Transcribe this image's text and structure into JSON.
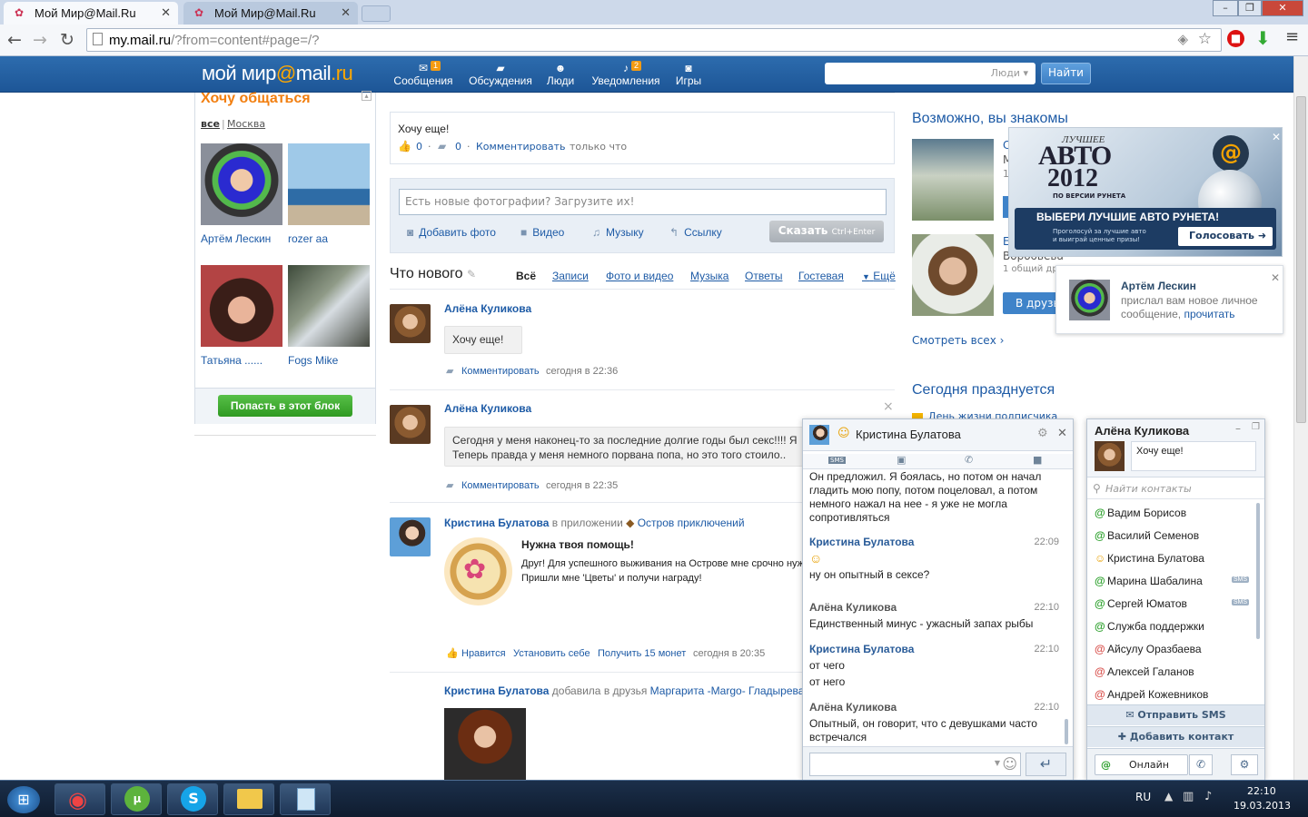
{
  "browser": {
    "tabs": [
      {
        "title": "Мой Мир@Mail.Ru",
        "active": true
      },
      {
        "title": "Мой Мир@Mail.Ru",
        "active": false
      }
    ],
    "url_host": "my.mail.ru",
    "url_path": "/?from=content#page=/?"
  },
  "header": {
    "logo_a": "мой мир",
    "logo_at": "@",
    "logo_b": "mail",
    "logo_c": ".ru",
    "nav": [
      {
        "label": "Сообщения",
        "badge": "1",
        "icon": "envelope-icon"
      },
      {
        "label": "Обсуждения",
        "icon": "chat-icon"
      },
      {
        "label": "Люди",
        "icon": "people-icon"
      },
      {
        "label": "Уведомления",
        "badge": "2",
        "icon": "bell-icon"
      },
      {
        "label": "Игры",
        "icon": "gamepad-icon"
      }
    ],
    "search_scope": "Люди",
    "search_button": "Найти"
  },
  "left": {
    "title": "Хочу общаться",
    "filter_all": "все",
    "filter_sep": "|",
    "filter_city": "Москва",
    "people": [
      {
        "name": "Артём Лескин"
      },
      {
        "name": "rozer aa"
      },
      {
        "name": "Татьяна ......"
      },
      {
        "name": "Fogs Mike"
      }
    ],
    "join_button": "Попасть в этот блок"
  },
  "status_post": {
    "text": "Хочу еще!",
    "likes": "0",
    "comments": "0",
    "comment_link": "Комментировать",
    "time": "только что",
    "dot": "·"
  },
  "upload": {
    "placeholder": "Есть новые фотографии? Загрузите их!",
    "add_photo": "Добавить фото",
    "video": "Видео",
    "music": "Музыку",
    "link": "Ссылку",
    "say": "Сказать",
    "say_kbd": "Ctrl+Enter"
  },
  "feed": {
    "title": "Что нового",
    "tabs": [
      "Всё",
      "Записи",
      "Фото и видео",
      "Музыка",
      "Ответы",
      "Гостевая",
      "Ещё"
    ],
    "items": [
      {
        "author": "Алёна Куликова",
        "text": "Хочу еще!",
        "comment": "Комментировать",
        "time": "сегодня в 22:36"
      },
      {
        "author": "Алёна Куликова",
        "text1": "Сегодня у меня наконец-то за последние долгие годы был секс!!!! Я",
        "text2": "Теперь правда у меня немного порвана попа, но это того стоило..",
        "comment": "Комментировать",
        "time": "сегодня в 22:35",
        "close": "×"
      },
      {
        "author": "Кристина Булатова",
        "in_app": "в приложении",
        "app": "Остров приключений",
        "headline": "Нужна твоя помощь!",
        "body1": "Друг! Для успешного выживания на Острове мне срочно нуж",
        "body2": "Пришли мне 'Цветы' и получи награду!",
        "like": "Нравится",
        "install": "Установить себе",
        "get": "Получить 15 монет",
        "time": "сегодня в 20:35"
      },
      {
        "author": "Кристина Булатова",
        "added": "добавила в друзья",
        "friend": "Маргарита -Margo- Гладырева"
      }
    ]
  },
  "right": {
    "maybe_title": "Возможно, вы знакомы",
    "suggest_name_frag": "Е",
    "suggest_surname": "Воробьева",
    "common": "1 общий др",
    "add_friend": "В друзь",
    "see_all": "Смотреть всех",
    "see_all_arrow": "›",
    "today_title": "Сегодня празднуется",
    "today_sub": "День жизни подписчика",
    "side_frag": "С",
    "side_frag2": "М",
    "side_frag3": "1"
  },
  "ad": {
    "top": "ЛУЧШЕЕ",
    "brand": "АВТО",
    "year": "2012",
    "by": "ПО ВЕРСИИ РУНЕТА",
    "headline": "ВЫБЕРИ ЛУЧШИЕ АВТО РУНЕТА!",
    "sub1": "Проголосуй за лучшие авто",
    "sub2": "и выиграй ценные призы!",
    "vote": "Голосовать"
  },
  "notification": {
    "name": "Артём Лескин",
    "line1": "прислал вам новое личное",
    "line2": "сообщение,",
    "action": "прочитать"
  },
  "chat": {
    "title": "Кристина Булатова",
    "tool_sms": "SMS",
    "intro": "Он предложил. Я боялась, но потом он начал гладить мою попу, потом поцеловал, а потом немного нажал на нее - я уже не могла сопротивляться",
    "messages": [
      {
        "who": "Кристина Булатова",
        "time": "22:09",
        "lines": [
          "☺",
          "ну он опытный в сексе?"
        ]
      },
      {
        "who": "Алёна Куликова",
        "time": "22:10",
        "lines": [
          "Единственный минус - ужасный запах рыбы"
        ]
      },
      {
        "who": "Кристина Булатова",
        "time": "22:10",
        "lines": [
          "от чего",
          "от него"
        ]
      },
      {
        "who": "Алёна Куликова",
        "time": "22:10",
        "lines": [
          "Опытный, он говорит, что с девушками часто",
          "встречался"
        ]
      }
    ]
  },
  "contacts": {
    "owner": "Алёна Куликова",
    "status": "Хочу еще!",
    "search_placeholder": "Найти контакты",
    "list": [
      {
        "name": "Вадим Борисов",
        "status": "online"
      },
      {
        "name": "Василий Семенов",
        "status": "online"
      },
      {
        "name": "Кристина Булатова",
        "status": "smile"
      },
      {
        "name": "Марина Шабалина",
        "status": "online",
        "sms": "SMS"
      },
      {
        "name": "Сергей Юматов",
        "status": "online",
        "sms": "SMS"
      },
      {
        "name": "Служба поддержки",
        "status": "online"
      },
      {
        "name": "Айсулу Оразбаева",
        "status": "offline"
      },
      {
        "name": "Алексей Галанов",
        "status": "offline"
      },
      {
        "name": "Андрей Кожевников",
        "status": "offline"
      }
    ],
    "send_sms": "Отправить SMS",
    "add_contact": "Добавить контакт",
    "online": "Онлайн"
  },
  "taskbar": {
    "lang": "RU",
    "time": "22:10",
    "date": "19.03.2013"
  },
  "colors": {
    "header_blue": "#1d5697",
    "link": "#1e5ba6",
    "orange": "#f27f10",
    "green": "#2f9a22"
  }
}
